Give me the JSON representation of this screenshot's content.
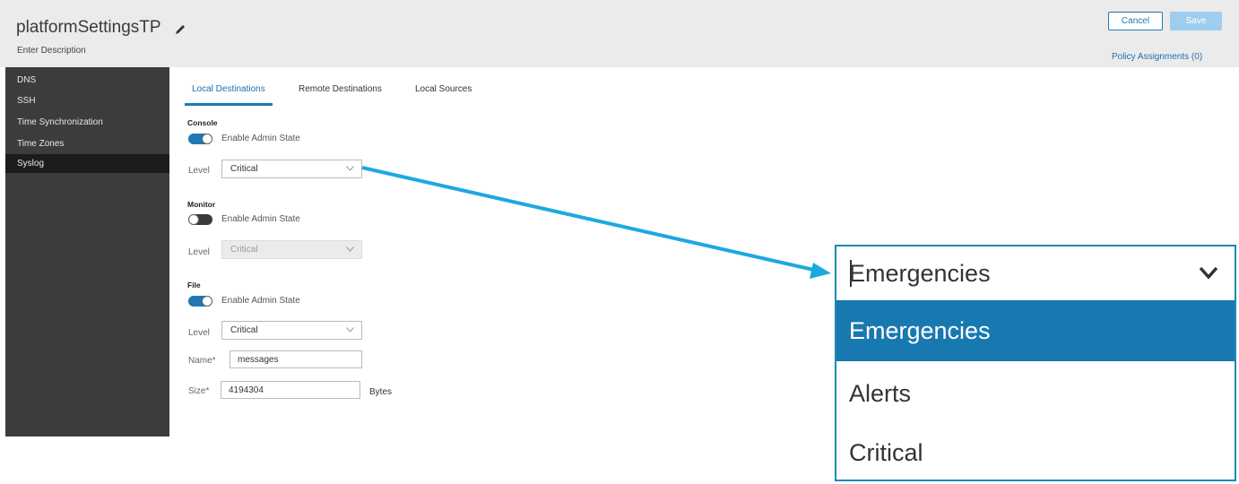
{
  "header": {
    "title": "platformSettingsTP",
    "description": "Enter Description",
    "cancel_label": "Cancel",
    "save_label": "Save",
    "policy_assignments": "Policy Assignments (0)"
  },
  "sidebar": {
    "items": [
      {
        "label": "DNS"
      },
      {
        "label": "SSH"
      },
      {
        "label": "Time Synchronization"
      },
      {
        "label": "Time Zones"
      },
      {
        "label": "Syslog",
        "active": true
      }
    ]
  },
  "tabs": [
    {
      "label": "Local Destinations",
      "active": true
    },
    {
      "label": "Remote Destinations"
    },
    {
      "label": "Local Sources"
    }
  ],
  "console": {
    "section": "Console",
    "toggle_label": "Enable Admin State",
    "enabled": true,
    "level_label": "Level",
    "level_value": "Critical"
  },
  "monitor": {
    "section": "Monitor",
    "toggle_label": "Enable Admin State",
    "enabled": false,
    "level_label": "Level",
    "level_value": "Critical"
  },
  "file": {
    "section": "File",
    "toggle_label": "Enable Admin State",
    "enabled": true,
    "level_label": "Level",
    "level_value": "Critical",
    "name_label": "Name*",
    "name_value": "messages",
    "size_label": "Size*",
    "size_value": "4194304",
    "size_unit": "Bytes"
  },
  "zoom_dropdown": {
    "current_value": "Emergencies",
    "options": [
      "Emergencies",
      "Alerts",
      "Critical"
    ],
    "highlighted_index": 0
  },
  "colors": {
    "accent": "#1f78b4",
    "highlight": "#1879b0",
    "arrow": "#1ca9e0",
    "sidebar_bg": "#3c3c3c",
    "sidebar_active": "#1c1c1c"
  }
}
